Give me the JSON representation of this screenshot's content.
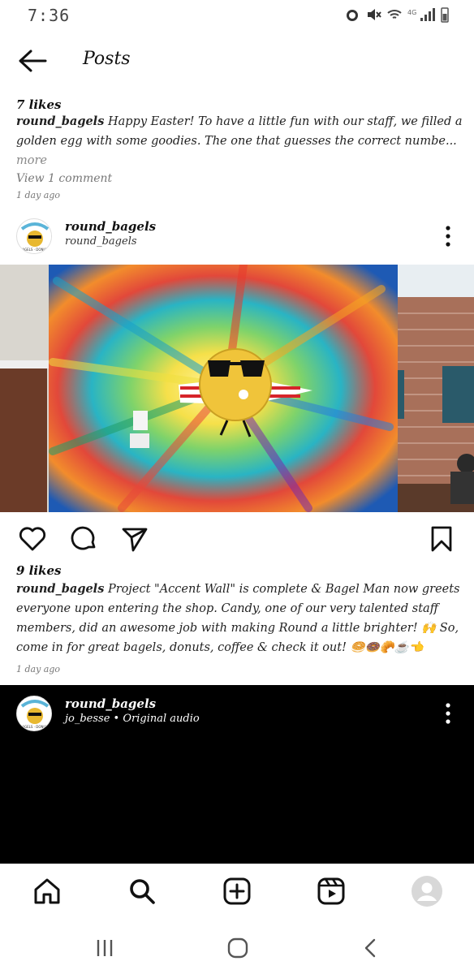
{
  "status_bar": {
    "time": "7:36"
  },
  "header": {
    "title": "Posts"
  },
  "post1": {
    "likes": "7 likes",
    "username": "round_bagels",
    "caption": " Happy Easter! To have a little fun with our staff, we filled a golden egg with some goodies. The one that guesses the correct numbe...",
    "more": " more",
    "view_comments": "View 1 comment",
    "time_ago": "1 day ago"
  },
  "post2": {
    "username": "round_bagels",
    "subtitle": "round_bagels",
    "likes": "9 likes",
    "caption_user": "round_bagels",
    "caption": " Project \"Accent Wall\" is complete & Bagel Man now greets everyone upon entering the shop. Candy, one of our very talented staff members, did an awesome job with making Round a little brighter! 🙌 So, come in for great bagels, donuts, coffee & check it out! 🥯🍩🥐☕👈",
    "time_ago": "1 day ago"
  },
  "post3": {
    "username": "round_bagels",
    "subtitle": "jo_besse • Original audio"
  },
  "avatar_text": "ROUND",
  "bottom_nav": [
    "home-icon",
    "search-icon",
    "new-post-icon",
    "reels-icon",
    "profile-icon"
  ],
  "system_nav": [
    "recents-icon",
    "home-button-icon",
    "back-icon"
  ]
}
